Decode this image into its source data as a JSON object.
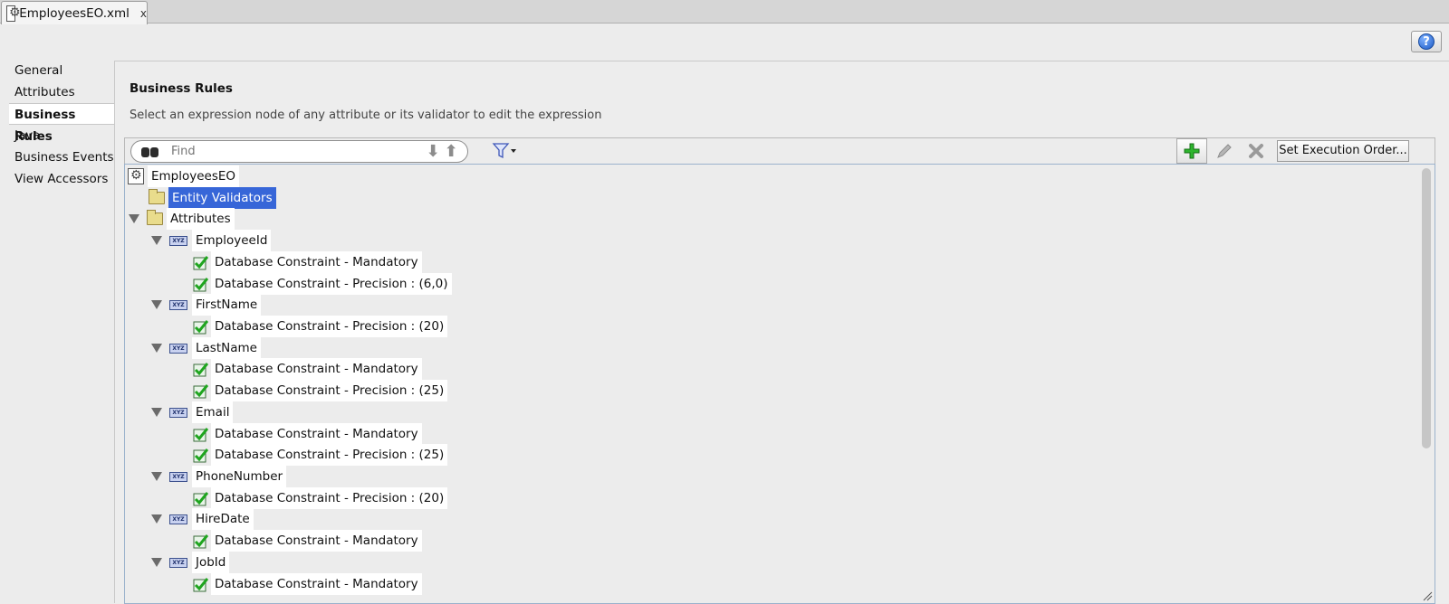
{
  "tab": {
    "title": "EmployeesEO.xml",
    "close": "x"
  },
  "help": {
    "label": "?"
  },
  "nav": {
    "items": [
      {
        "label": "General"
      },
      {
        "label": "Attributes"
      },
      {
        "label": "Business Rules",
        "active": true
      },
      {
        "label": "Java"
      },
      {
        "label": "Business Events"
      },
      {
        "label": "View Accessors"
      }
    ]
  },
  "section": {
    "title": "Business Rules",
    "description": "Select an expression node of any attribute or its validator to edit the expression"
  },
  "toolbar": {
    "find_placeholder": "Find",
    "exec_order_label": "Set Execution Order..."
  },
  "tree": {
    "root": "EmployeesEO",
    "entity_validators": "Entity Validators",
    "attributes": "Attributes",
    "attrs": [
      {
        "name": "EmployeeId",
        "rules": [
          "Database Constraint - Mandatory",
          "Database Constraint - Precision : (6,0)"
        ]
      },
      {
        "name": "FirstName",
        "rules": [
          "Database Constraint - Precision : (20)"
        ]
      },
      {
        "name": "LastName",
        "rules": [
          "Database Constraint - Mandatory",
          "Database Constraint - Precision : (25)"
        ]
      },
      {
        "name": "Email",
        "rules": [
          "Database Constraint - Mandatory",
          "Database Constraint - Precision : (25)"
        ]
      },
      {
        "name": "PhoneNumber",
        "rules": [
          "Database Constraint - Precision : (20)"
        ]
      },
      {
        "name": "HireDate",
        "rules": [
          "Database Constraint - Mandatory"
        ]
      },
      {
        "name": "JobId",
        "rules": [
          "Database Constraint - Mandatory"
        ]
      }
    ]
  },
  "colors": {
    "selection": "#3766d8",
    "add_icon": "#22a322",
    "check": "#1fa51f"
  }
}
